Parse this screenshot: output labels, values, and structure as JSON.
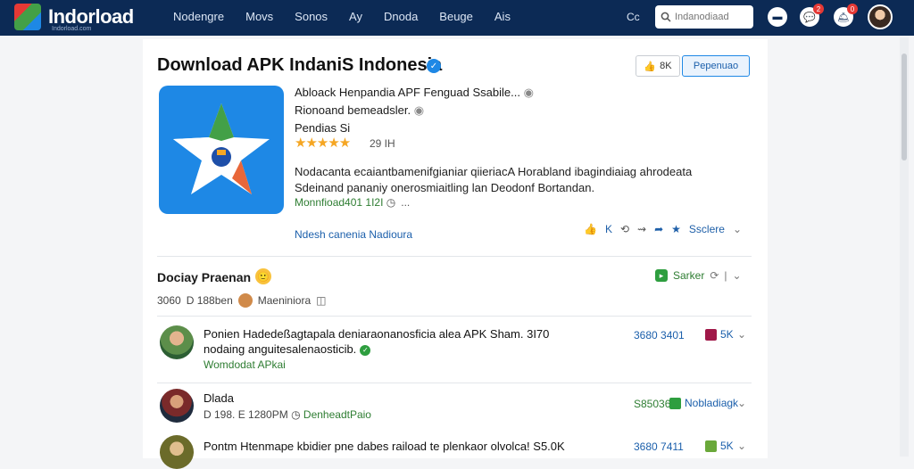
{
  "header": {
    "logo": "Indorload",
    "logo_sub": "Indorload.com",
    "nav": [
      "Nodengre",
      "Movs",
      "Sonos",
      "Ay",
      "Dnoda",
      "Beuge",
      "Ais"
    ],
    "cc": "Cc",
    "search_placeholder": "Indanodiaad",
    "notif_count_1": "2",
    "notif_count_2": "0"
  },
  "app": {
    "title": "Download APK IndaniS Indonesia",
    "like_label": "8K",
    "follow_label": "Pepenuao",
    "meta1": "Abloack Henpandia APF Fenguad Ssabile...",
    "meta2": "Rionoand bemeadsler.",
    "meta3": "Pendias Si",
    "stars": "★★★★★",
    "rating_count": "29 IH",
    "desc": "Nodacanta ecaiantbamenifgianiar qiieriacA Horabland ibagindiaiag ahrodeata Sdeinand pananiy onerosmiaitling lan Deodonf Bortandan.",
    "download_line": "Monnfioad401 1I2I",
    "download_ext": "...",
    "more_link": "Ndesh canenia Nadioura",
    "action_count": "K",
    "action_save": "Ssclere"
  },
  "section": {
    "title": "Dociay Praenan",
    "meta_a": "3060",
    "meta_b": "D 188ben",
    "meta_c": "Maeniniora",
    "sort_label": "Sarker"
  },
  "rows": [
    {
      "text": "Ponien Hadedeßagtapala deniaraonanosficia alea APK Sham. 3I70",
      "text2": "nodaing anguitesalenaosticib.",
      "sub": "Womdodat APkai",
      "count": "3680 3401",
      "tag": "5K",
      "tag_color": "#a01848"
    },
    {
      "text": "Dlada",
      "meta": "D 198.  E 1280PM",
      "sub": "DenheadtPaio",
      "count": "S85036",
      "tag": "Nobladiagk",
      "tag_color": "#2e9e3f"
    },
    {
      "text": "Pontm Htenmape kbidier pne dabes  raiload te plenkaor olvolca! S5.0K",
      "count": "3680 7411",
      "tag": "5K",
      "tag_color": "#6aa83a"
    }
  ],
  "colors": {
    "topbar": "#0c2a55",
    "accent_blue": "#1e88e5",
    "green": "#2e7d32"
  }
}
